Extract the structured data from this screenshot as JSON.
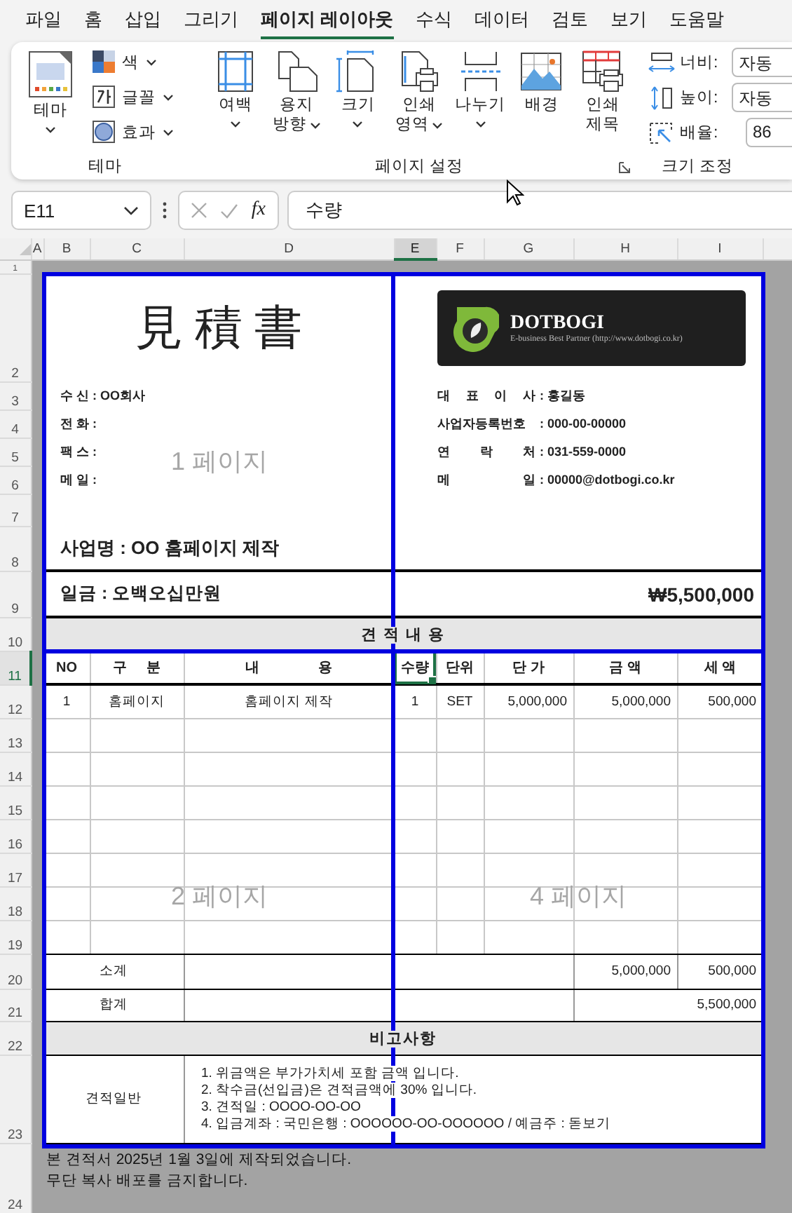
{
  "menu_tabs": [
    {
      "label": "파일",
      "selected": false
    },
    {
      "label": "홈",
      "selected": false
    },
    {
      "label": "삽입",
      "selected": false
    },
    {
      "label": "그리기",
      "selected": false
    },
    {
      "label": "페이지 레이아웃",
      "selected": true
    },
    {
      "label": "수식",
      "selected": false
    },
    {
      "label": "데이터",
      "selected": false
    },
    {
      "label": "검토",
      "selected": false
    },
    {
      "label": "보기",
      "selected": false
    },
    {
      "label": "도움말",
      "selected": false
    }
  ],
  "ribbon": {
    "theme": {
      "label": "테마",
      "big_button": "테마",
      "small_buttons": [
        "색",
        "글꼴",
        "효과"
      ]
    },
    "page_setup": {
      "label": "페이지 설정",
      "buttons": [
        {
          "label": "여백",
          "kind": "menu-below"
        },
        {
          "label": "용지\n방향",
          "kind": "menu-inline"
        },
        {
          "label": "크기",
          "kind": "menu-below"
        },
        {
          "label": "인쇄\n영역",
          "kind": "menu-inline"
        },
        {
          "label": "나누기",
          "kind": "menu-below"
        },
        {
          "label": "배경",
          "kind": "plain"
        },
        {
          "label": "인쇄\n제목",
          "kind": "plain"
        }
      ]
    },
    "scale": {
      "label": "크기 조정",
      "fields": [
        {
          "label": "너비:",
          "value": "자동"
        },
        {
          "label": "높이:",
          "value": "자동"
        },
        {
          "label": "배율:",
          "value": "86"
        }
      ]
    }
  },
  "formula_bar": {
    "name_box": "E11",
    "function_label": "fx",
    "formula": "수량"
  },
  "columns": [
    {
      "label": "A",
      "selected": false
    },
    {
      "label": "B",
      "selected": false
    },
    {
      "label": "C",
      "selected": false
    },
    {
      "label": "D",
      "selected": false
    },
    {
      "label": "E",
      "selected": true
    },
    {
      "label": "F",
      "selected": false
    },
    {
      "label": "G",
      "selected": false
    },
    {
      "label": "H",
      "selected": false
    },
    {
      "label": "I",
      "selected": false
    }
  ],
  "rows": [
    {
      "label": "1",
      "selected": false
    },
    {
      "label": "2",
      "selected": false
    },
    {
      "label": "3",
      "selected": false
    },
    {
      "label": "4",
      "selected": false
    },
    {
      "label": "5",
      "selected": false
    },
    {
      "label": "6",
      "selected": false
    },
    {
      "label": "7",
      "selected": false
    },
    {
      "label": "8",
      "selected": false
    },
    {
      "label": "9",
      "selected": false
    },
    {
      "label": "10",
      "selected": false
    },
    {
      "label": "11",
      "selected": true
    },
    {
      "label": "12",
      "selected": false
    },
    {
      "label": "13",
      "selected": false
    },
    {
      "label": "14",
      "selected": false
    },
    {
      "label": "15",
      "selected": false
    },
    {
      "label": "16",
      "selected": false
    },
    {
      "label": "17",
      "selected": false
    },
    {
      "label": "18",
      "selected": false
    },
    {
      "label": "19",
      "selected": false
    },
    {
      "label": "20",
      "selected": false
    },
    {
      "label": "21",
      "selected": false
    },
    {
      "label": "22",
      "selected": false
    },
    {
      "label": "23",
      "selected": false
    },
    {
      "label": "24",
      "selected": false
    }
  ],
  "quote": {
    "title": "見 積 書",
    "logo": {
      "name": "DOTBOGI",
      "tagline": "E-business Best Partner  (http://www.dotbogi.co.kr)"
    },
    "recipient_lines": [
      "수 신 : OO회사",
      "전 화 :",
      "팩 스 :",
      "메 일 :"
    ],
    "supplier": [
      {
        "label": "대 표 이 사",
        "value": ": 홍길동"
      },
      {
        "label": "사업자등록번호",
        "value": ": 000-00-00000"
      },
      {
        "label": "연 락 처",
        "value": ": 031-559-0000"
      },
      {
        "label": "메 일",
        "value": ": 00000@dotbogi.co.kr"
      }
    ],
    "project": "사업명 : OO 홈페이지 제작",
    "amount_words": "일금 : 오백오십만원",
    "amount": "₩5,500,000",
    "section_title": "견 적 내 용",
    "item_columns": [
      "NO",
      "구     분",
      "내               용",
      "수량",
      "단위",
      "단 가",
      "금 액",
      "세 액"
    ],
    "items": [
      {
        "no": "1",
        "category": "홈페이지",
        "description": "홈페이지 제작",
        "qty": "1",
        "unit": "SET",
        "unit_price": "5,000,000",
        "amount": "5,000,000",
        "tax": "500,000"
      }
    ],
    "subtotal": {
      "label": "소계",
      "amount": "5,000,000",
      "tax": "500,000"
    },
    "total": {
      "label": "합계",
      "value": "5,500,000"
    },
    "notes_title": "비고사항",
    "notes_label": "견적일반",
    "notes": [
      "1. 위금액은 부가가치세 포함 금액 입니다.",
      "2. 착수금(선입금)은 견적금액에 30% 입니다.",
      "3. 견적일 : OOOO-OO-OO",
      "4. 입금계좌 : 국민은행 : OOOOOO-OO-OOOOOO  / 예금주 : 돋보기"
    ]
  },
  "footer_lines": [
    "본 견적서 2025년 1월  3일에 제작되었습니다.",
    "무단 복사 배포를 금지합니다."
  ],
  "page_labels": [
    "1 페이지",
    "2 페이지",
    "4 페이지"
  ]
}
